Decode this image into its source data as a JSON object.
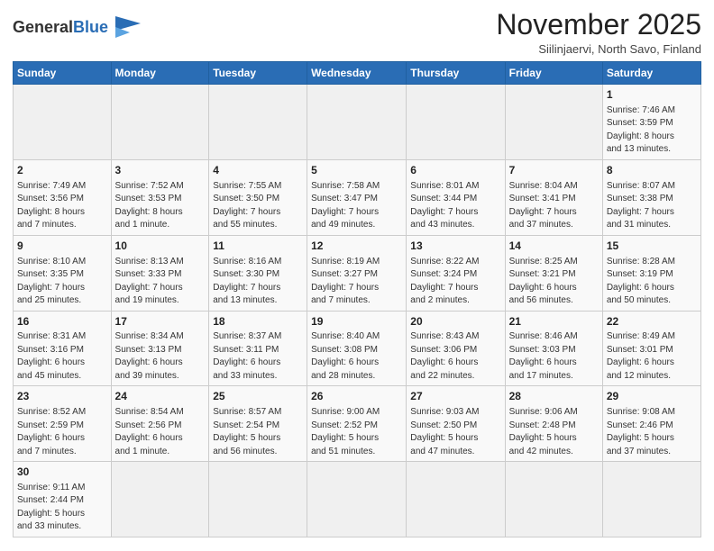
{
  "logo": {
    "text_general": "General",
    "text_blue": "Blue"
  },
  "title": "November 2025",
  "location": "Siilinjaervi, North Savo, Finland",
  "header_days": [
    "Sunday",
    "Monday",
    "Tuesday",
    "Wednesday",
    "Thursday",
    "Friday",
    "Saturday"
  ],
  "weeks": [
    [
      {
        "day": "",
        "info": ""
      },
      {
        "day": "",
        "info": ""
      },
      {
        "day": "",
        "info": ""
      },
      {
        "day": "",
        "info": ""
      },
      {
        "day": "",
        "info": ""
      },
      {
        "day": "",
        "info": ""
      },
      {
        "day": "1",
        "info": "Sunrise: 7:46 AM\nSunset: 3:59 PM\nDaylight: 8 hours\nand 13 minutes."
      }
    ],
    [
      {
        "day": "2",
        "info": "Sunrise: 7:49 AM\nSunset: 3:56 PM\nDaylight: 8 hours\nand 7 minutes."
      },
      {
        "day": "3",
        "info": "Sunrise: 7:52 AM\nSunset: 3:53 PM\nDaylight: 8 hours\nand 1 minute."
      },
      {
        "day": "4",
        "info": "Sunrise: 7:55 AM\nSunset: 3:50 PM\nDaylight: 7 hours\nand 55 minutes."
      },
      {
        "day": "5",
        "info": "Sunrise: 7:58 AM\nSunset: 3:47 PM\nDaylight: 7 hours\nand 49 minutes."
      },
      {
        "day": "6",
        "info": "Sunrise: 8:01 AM\nSunset: 3:44 PM\nDaylight: 7 hours\nand 43 minutes."
      },
      {
        "day": "7",
        "info": "Sunrise: 8:04 AM\nSunset: 3:41 PM\nDaylight: 7 hours\nand 37 minutes."
      },
      {
        "day": "8",
        "info": "Sunrise: 8:07 AM\nSunset: 3:38 PM\nDaylight: 7 hours\nand 31 minutes."
      }
    ],
    [
      {
        "day": "9",
        "info": "Sunrise: 8:10 AM\nSunset: 3:35 PM\nDaylight: 7 hours\nand 25 minutes."
      },
      {
        "day": "10",
        "info": "Sunrise: 8:13 AM\nSunset: 3:33 PM\nDaylight: 7 hours\nand 19 minutes."
      },
      {
        "day": "11",
        "info": "Sunrise: 8:16 AM\nSunset: 3:30 PM\nDaylight: 7 hours\nand 13 minutes."
      },
      {
        "day": "12",
        "info": "Sunrise: 8:19 AM\nSunset: 3:27 PM\nDaylight: 7 hours\nand 7 minutes."
      },
      {
        "day": "13",
        "info": "Sunrise: 8:22 AM\nSunset: 3:24 PM\nDaylight: 7 hours\nand 2 minutes."
      },
      {
        "day": "14",
        "info": "Sunrise: 8:25 AM\nSunset: 3:21 PM\nDaylight: 6 hours\nand 56 minutes."
      },
      {
        "day": "15",
        "info": "Sunrise: 8:28 AM\nSunset: 3:19 PM\nDaylight: 6 hours\nand 50 minutes."
      }
    ],
    [
      {
        "day": "16",
        "info": "Sunrise: 8:31 AM\nSunset: 3:16 PM\nDaylight: 6 hours\nand 45 minutes."
      },
      {
        "day": "17",
        "info": "Sunrise: 8:34 AM\nSunset: 3:13 PM\nDaylight: 6 hours\nand 39 minutes."
      },
      {
        "day": "18",
        "info": "Sunrise: 8:37 AM\nSunset: 3:11 PM\nDaylight: 6 hours\nand 33 minutes."
      },
      {
        "day": "19",
        "info": "Sunrise: 8:40 AM\nSunset: 3:08 PM\nDaylight: 6 hours\nand 28 minutes."
      },
      {
        "day": "20",
        "info": "Sunrise: 8:43 AM\nSunset: 3:06 PM\nDaylight: 6 hours\nand 22 minutes."
      },
      {
        "day": "21",
        "info": "Sunrise: 8:46 AM\nSunset: 3:03 PM\nDaylight: 6 hours\nand 17 minutes."
      },
      {
        "day": "22",
        "info": "Sunrise: 8:49 AM\nSunset: 3:01 PM\nDaylight: 6 hours\nand 12 minutes."
      }
    ],
    [
      {
        "day": "23",
        "info": "Sunrise: 8:52 AM\nSunset: 2:59 PM\nDaylight: 6 hours\nand 7 minutes."
      },
      {
        "day": "24",
        "info": "Sunrise: 8:54 AM\nSunset: 2:56 PM\nDaylight: 6 hours\nand 1 minute."
      },
      {
        "day": "25",
        "info": "Sunrise: 8:57 AM\nSunset: 2:54 PM\nDaylight: 5 hours\nand 56 minutes."
      },
      {
        "day": "26",
        "info": "Sunrise: 9:00 AM\nSunset: 2:52 PM\nDaylight: 5 hours\nand 51 minutes."
      },
      {
        "day": "27",
        "info": "Sunrise: 9:03 AM\nSunset: 2:50 PM\nDaylight: 5 hours\nand 47 minutes."
      },
      {
        "day": "28",
        "info": "Sunrise: 9:06 AM\nSunset: 2:48 PM\nDaylight: 5 hours\nand 42 minutes."
      },
      {
        "day": "29",
        "info": "Sunrise: 9:08 AM\nSunset: 2:46 PM\nDaylight: 5 hours\nand 37 minutes."
      }
    ],
    [
      {
        "day": "30",
        "info": "Sunrise: 9:11 AM\nSunset: 2:44 PM\nDaylight: 5 hours\nand 33 minutes."
      },
      {
        "day": "",
        "info": ""
      },
      {
        "day": "",
        "info": ""
      },
      {
        "day": "",
        "info": ""
      },
      {
        "day": "",
        "info": ""
      },
      {
        "day": "",
        "info": ""
      },
      {
        "day": "",
        "info": ""
      }
    ]
  ]
}
